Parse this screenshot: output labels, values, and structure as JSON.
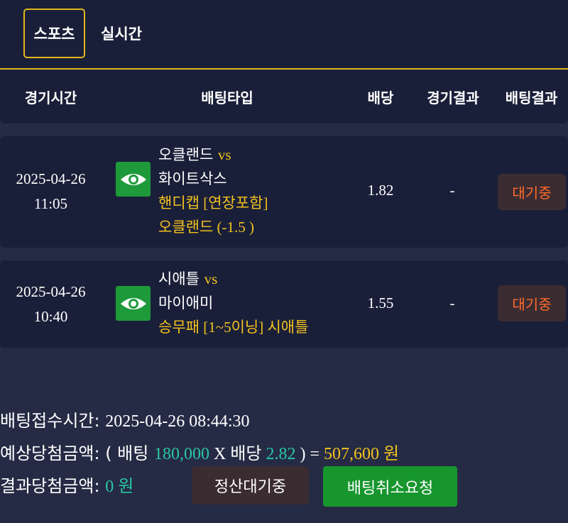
{
  "tabs": [
    {
      "label": "스포츠",
      "active": true
    },
    {
      "label": "실시간",
      "active": false
    }
  ],
  "columns": [
    "경기시간",
    "배팅타입",
    "배당",
    "경기결과",
    "배팅결과"
  ],
  "bets": [
    {
      "date": "2025-04-26",
      "time": "11:05",
      "home": "오클랜드",
      "vs": "vs",
      "away": "화이트삭스",
      "market": "핸디캡 [연장포함]",
      "pick": "오클랜드 (-1.5 )",
      "odds": "1.82",
      "result": "-",
      "status": "대기중"
    },
    {
      "date": "2025-04-26",
      "time": "10:40",
      "home": "시애틀",
      "vs": "vs",
      "away": "마이애미",
      "market": "승무패 [1~5이닝] 시애틀",
      "odds": "1.55",
      "result": "-",
      "status": "대기중"
    }
  ],
  "summary": {
    "received_label": "배팅접수시간: ",
    "received_value": "2025-04-26 08:44:30",
    "expected_label": "예상당첨금액: ( 배팅 ",
    "stake": "180,000",
    "x_label": " X 배당 ",
    "total_odds": "2.82",
    "equals": " ) = ",
    "expected_amount": "507,600 원",
    "actual_label": "결과당첨금액: ",
    "actual_amount": "0 원"
  },
  "buttons": {
    "settle_wait": "정산대기중",
    "cancel_request": "배팅취소요청"
  },
  "colors": {
    "background": "#252b45",
    "panel": "#1a1f39",
    "accent_gold": "#f2c21e",
    "teal": "#2bc6a4",
    "status_orange": "#ff6a2a",
    "eye_green": "#1f9a3a"
  },
  "icons": {
    "detail": "eye-icon"
  }
}
